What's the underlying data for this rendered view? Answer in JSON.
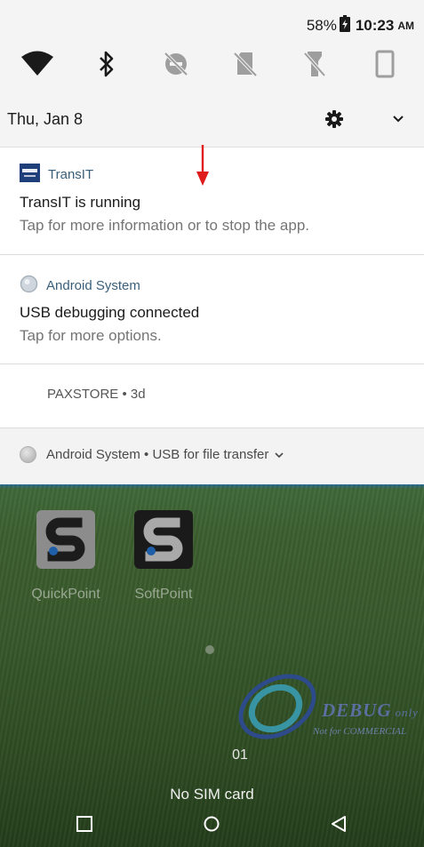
{
  "status_bar": {
    "battery": "58%",
    "time": "10:23",
    "ampm": "AM"
  },
  "quick_settings": [
    {
      "name": "wifi",
      "icon": "wifi-icon"
    },
    {
      "name": "bluetooth",
      "icon": "bluetooth-icon"
    },
    {
      "name": "do-not-disturb",
      "icon": "dnd-off-icon"
    },
    {
      "name": "sim",
      "icon": "no-sim-icon"
    },
    {
      "name": "flashlight",
      "icon": "flashlight-off-icon"
    },
    {
      "name": "rotation",
      "icon": "portrait-icon"
    }
  ],
  "header": {
    "date": "Thu, Jan 8"
  },
  "notifications": [
    {
      "app": "TransIT",
      "title": "TransIT is running",
      "body": "Tap for more information or to stop the app."
    },
    {
      "app": "Android System",
      "title": "USB debugging connected",
      "body": "Tap for more options."
    }
  ],
  "paxstore": {
    "text": "PAXSTORE • 3d"
  },
  "collapsed": {
    "text": "Android System • USB for file transfer"
  },
  "home": {
    "apps": [
      {
        "label": "QuickPoint"
      },
      {
        "label": "SoftPoint"
      }
    ],
    "watermark_main": "DEBUG",
    "watermark_only": "only",
    "watermark_sub": "Not for COMMERCIAL",
    "slot_number": "01",
    "sim_status": "No SIM card"
  },
  "colors": {
    "accent_arrow": "#e01b1b",
    "notification_app": "#3a5f7a",
    "transit_brand": "#1e3f7a"
  }
}
